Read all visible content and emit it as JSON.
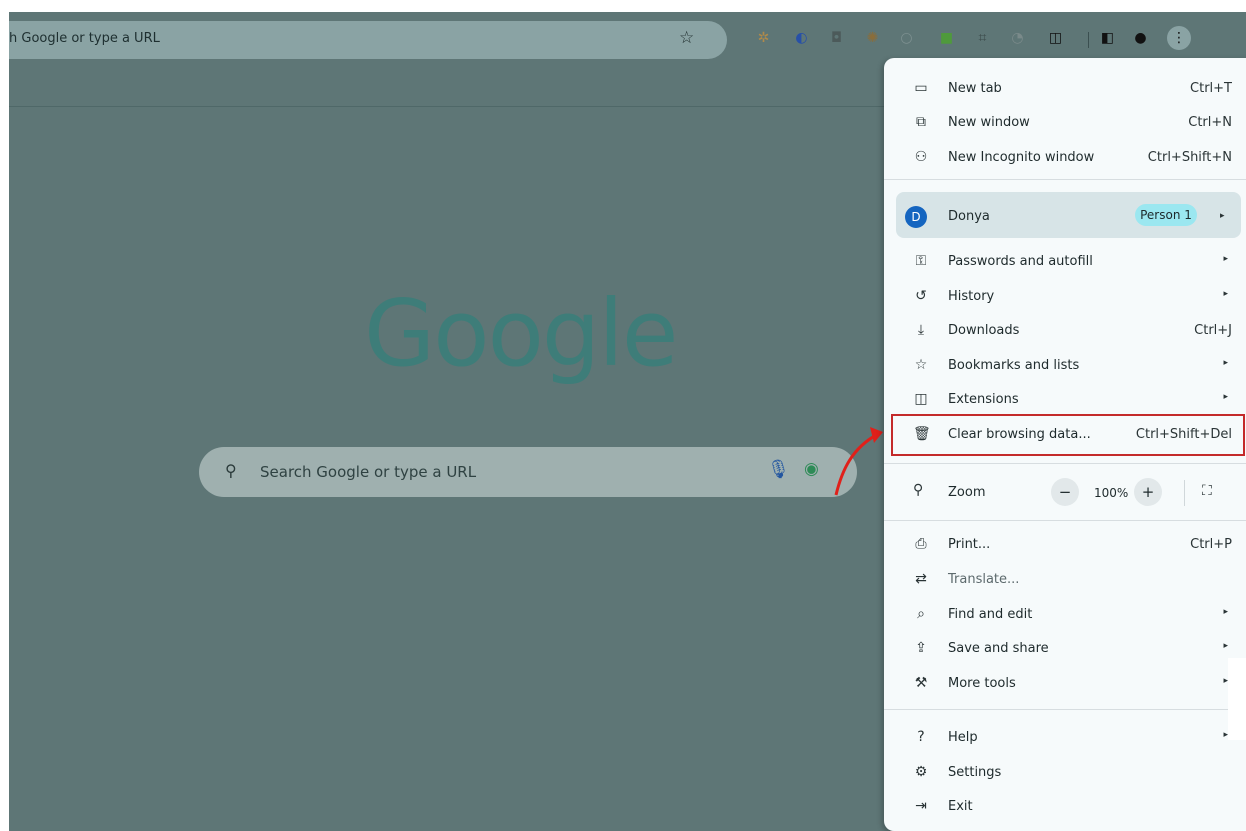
{
  "omnibox": {
    "text": "h Google or type a URL"
  },
  "toolbar": {
    "extensions": [
      {
        "icon": "puzzle-gear-icon",
        "glyph": "✲",
        "color": "#b08a4a"
      },
      {
        "icon": "shazam-like-icon",
        "glyph": "◐",
        "color": "#2750a8"
      },
      {
        "icon": "camera-icon",
        "glyph": "◘",
        "color": "#4c5a5a"
      },
      {
        "icon": "sun-icon",
        "glyph": "✺",
        "color": "#8a6d3a"
      },
      {
        "icon": "dim-circle-icon",
        "glyph": "○",
        "color": "#7d9090"
      },
      {
        "icon": "green-square-icon",
        "glyph": "■",
        "color": "#4f9a3c"
      },
      {
        "icon": "crop-icon",
        "glyph": "⌗",
        "color": "#3b4a4a"
      },
      {
        "icon": "clock-icon",
        "glyph": "◔",
        "color": "#7a8a8a"
      },
      {
        "icon": "puzzle-icon",
        "glyph": "◫",
        "color": "#111111"
      }
    ],
    "side_panel_icon": "side-panel-icon",
    "profile_icon": "profile-icon",
    "menu_icon": "menu-kebab-icon"
  },
  "ntp": {
    "logo": "Google",
    "search_placeholder": "Search Google or type a URL"
  },
  "menu": {
    "items": [
      {
        "name": "new-tab",
        "icon": "new-tab-icon",
        "glyph": "▭",
        "label": "New tab",
        "shortcut": "Ctrl+T"
      },
      {
        "name": "new-window",
        "icon": "new-window-icon",
        "glyph": "⧉",
        "label": "New window",
        "shortcut": "Ctrl+N"
      },
      {
        "name": "new-incognito-window",
        "icon": "incognito-icon",
        "glyph": "⚇",
        "label": "New Incognito window",
        "shortcut": "Ctrl+Shift+N"
      },
      {
        "name": "passwords-and-autofill",
        "icon": "key-icon",
        "glyph": "⚿",
        "label": "Passwords and autofill",
        "submenu": true
      },
      {
        "name": "history",
        "icon": "history-icon",
        "glyph": "↺",
        "label": "History",
        "submenu": true
      },
      {
        "name": "downloads",
        "icon": "download-icon",
        "glyph": "⤓",
        "label": "Downloads",
        "shortcut": "Ctrl+J"
      },
      {
        "name": "bookmarks-and-lists",
        "icon": "star-icon",
        "glyph": "☆",
        "label": "Bookmarks and lists",
        "submenu": true
      },
      {
        "name": "extensions",
        "icon": "puzzle-icon",
        "glyph": "◫",
        "label": "Extensions",
        "submenu": true
      },
      {
        "name": "clear-browsing-data",
        "icon": "trash-icon",
        "glyph": "🗑",
        "label": "Clear browsing data...",
        "shortcut": "Ctrl+Shift+Del"
      },
      {
        "name": "print",
        "icon": "printer-icon",
        "glyph": "⎙",
        "label": "Print...",
        "shortcut": "Ctrl+P"
      },
      {
        "name": "translate",
        "icon": "translate-icon",
        "glyph": "⇄",
        "label": "Translate...",
        "disabled": true
      },
      {
        "name": "find-and-edit",
        "icon": "find-icon",
        "glyph": "⌕",
        "label": "Find and edit",
        "submenu": true
      },
      {
        "name": "save-and-share",
        "icon": "share-icon",
        "glyph": "⇪",
        "label": "Save and share",
        "submenu": true
      },
      {
        "name": "more-tools",
        "icon": "toolbox-icon",
        "glyph": "⚒",
        "label": "More tools",
        "submenu": true
      },
      {
        "name": "help",
        "icon": "help-icon",
        "glyph": "?",
        "label": "Help",
        "submenu": true
      },
      {
        "name": "settings",
        "icon": "gear-icon",
        "glyph": "⚙",
        "label": "Settings"
      },
      {
        "name": "exit",
        "icon": "exit-icon",
        "glyph": "⇥",
        "label": "Exit"
      }
    ],
    "profile": {
      "initial": "D",
      "name": "Donya",
      "badge": "Person 1"
    },
    "zoom": {
      "label": "Zoom",
      "minus": "−",
      "value": "100%",
      "plus": "+"
    }
  },
  "colors": {
    "highlight": "#c42a2a",
    "arrow": "#e0201a",
    "backdrop": "#5e7676"
  }
}
